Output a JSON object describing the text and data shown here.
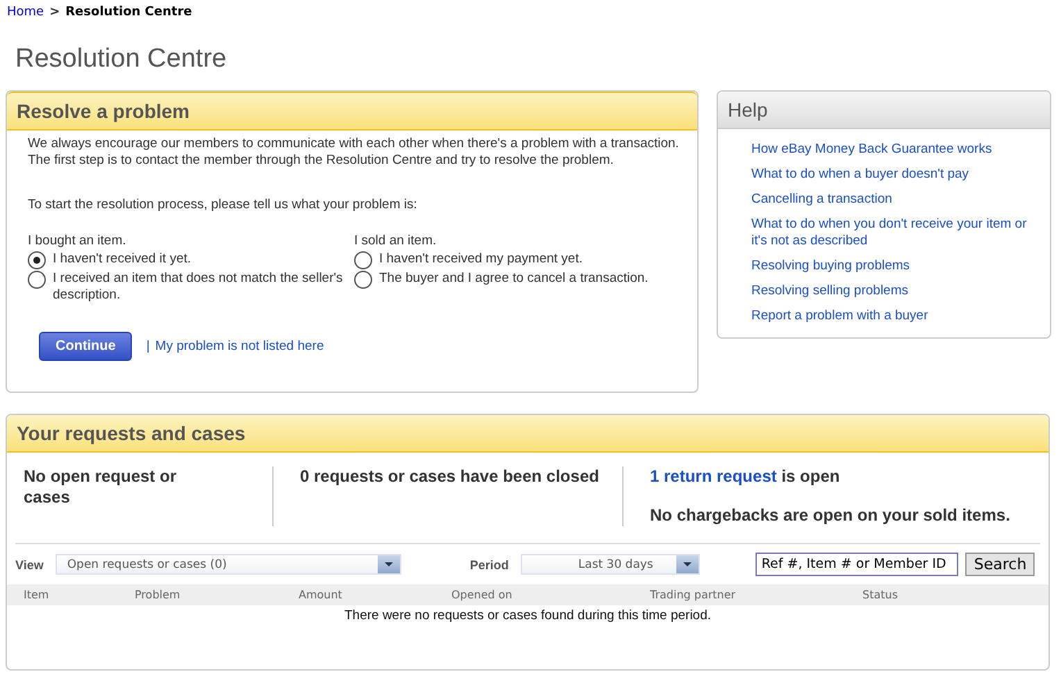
{
  "breadcrumb": {
    "link": "Home",
    "separator": ">",
    "current": "Resolution Centre"
  },
  "page_title": "Resolution Centre",
  "resolve_panel": {
    "title": "Resolve a problem",
    "intro": "We always encourage our members to communicate with each other when there's a problem with a transaction. The first step is to contact the member through the Resolution Centre and try to resolve the problem.",
    "prompt": "To start the resolution process, please tell us what your problem is:",
    "groups": [
      {
        "heading": "I bought an item.",
        "options": [
          {
            "label": "I haven't received it yet.",
            "selected": true
          },
          {
            "label": "I received an item that does not match the seller's description.",
            "selected": false
          }
        ]
      },
      {
        "heading": "I sold an item.",
        "options": [
          {
            "label": "I haven't received my payment yet.",
            "selected": false
          },
          {
            "label": "The buyer and I agree to cancel a transaction.",
            "selected": false
          }
        ]
      }
    ],
    "button": "Continue",
    "separator": "|",
    "link": "My problem is not listed here"
  },
  "help": {
    "title": "Help",
    "links": [
      "How eBay Money Back Guarantee works",
      "What to do when a buyer doesn't pay",
      "Cancelling a transaction",
      "What to do when you don't receive your item or it's not as described",
      "Resolving buying problems",
      "Resolving selling problems",
      "Report a problem with a buyer"
    ]
  },
  "requests_panel": {
    "title": "Your requests and cases",
    "summary_1": "No open request or cases",
    "summary_2": "0 requests or cases have been closed",
    "summary_3": {
      "link": "1 return request",
      "text": " is open"
    },
    "summary_4": "No chargebacks are open on your sold items.",
    "view": {
      "label": "View",
      "value": "Open requests or cases (0)"
    },
    "period": {
      "label": "Period",
      "value": "Last 30 days"
    },
    "search": {
      "value": "Ref #, Item # or Member ID",
      "button": "Search"
    },
    "table": {
      "columns": [
        "Item",
        "Problem",
        "Amount",
        "Opened on",
        "Trading partner",
        "Status"
      ],
      "empty_message": "There were no requests or cases found during this time period."
    }
  }
}
